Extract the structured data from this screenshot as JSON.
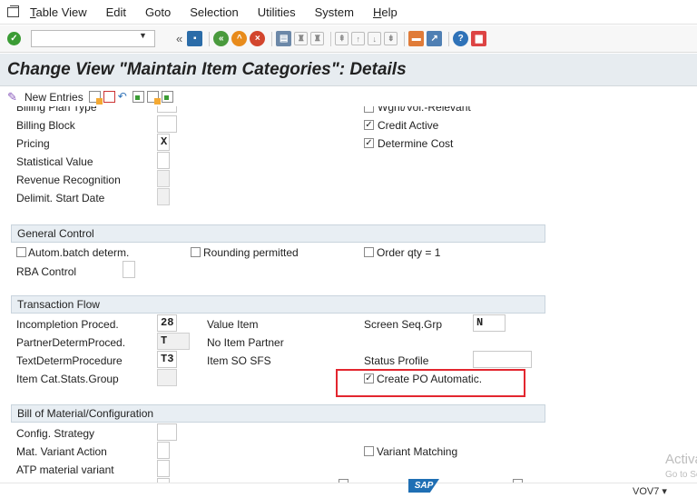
{
  "menubar": {
    "items": [
      {
        "underline": "T",
        "rest": "able View"
      },
      {
        "underline": "",
        "rest": "Edit"
      },
      {
        "underline": "",
        "rest": "Goto"
      },
      {
        "underline": "",
        "rest": "Selection"
      },
      {
        "underline": "",
        "rest": "Utilities"
      },
      {
        "underline": "",
        "rest": "System"
      },
      {
        "underline": "H",
        "rest": "elp"
      }
    ]
  },
  "toolbar": {
    "command_value": "",
    "back_label": "«"
  },
  "title": "Change View \"Maintain Item Categories\": Details",
  "apptoolbar": {
    "new_entries": "New Entries"
  },
  "upper": {
    "partial_label": "Billing Plan Type",
    "partial_right_label": "Wght/Vol.-Relevant",
    "billing_block": {
      "label": "Billing Block",
      "value": ""
    },
    "pricing": {
      "label": "Pricing",
      "value": "X"
    },
    "statistical_value": {
      "label": "Statistical Value",
      "value": ""
    },
    "revenue_recognition": {
      "label": "Revenue Recognition",
      "value": ""
    },
    "delimit_start": {
      "label": "Delimit. Start Date",
      "value": ""
    },
    "credit_active": {
      "label": "Credit Active",
      "checked": "✓"
    },
    "determine_cost": {
      "label": "Determine Cost",
      "checked": "✓"
    }
  },
  "general_control": {
    "title": "General Control",
    "autom_batch": {
      "label": "Autom.batch determ.",
      "checked": ""
    },
    "rounding": {
      "label": "Rounding permitted",
      "checked": ""
    },
    "order_qty": {
      "label": "Order qty = 1",
      "checked": ""
    },
    "rba": {
      "label": "RBA Control",
      "value": ""
    }
  },
  "transaction_flow": {
    "title": "Transaction Flow",
    "incompletion": {
      "label": "Incompletion Proced.",
      "value": "28",
      "desc": "Value Item"
    },
    "partner": {
      "label": "PartnerDetermProced.",
      "value": "T",
      "desc": "No Item Partner"
    },
    "text": {
      "label": "TextDetermProcedure",
      "value": "T3",
      "desc": "Item SO SFS"
    },
    "stats_group": {
      "label": "Item Cat.Stats.Group",
      "value": ""
    },
    "screen_seq": {
      "label": "Screen Seq.Grp",
      "value": "N"
    },
    "status_profile": {
      "label": "Status Profile",
      "value": ""
    },
    "create_po": {
      "label": "Create PO Automatic.",
      "checked": "✓"
    }
  },
  "bom": {
    "title": "Bill of Material/Configuration",
    "config_strategy": {
      "label": "Config. Strategy",
      "value": ""
    },
    "mat_variant": {
      "label": "Mat. Variant Action",
      "value": ""
    },
    "atp_variant": {
      "label": "ATP material variant",
      "value": ""
    },
    "variant_matching": {
      "label": "Variant Matching",
      "checked": ""
    }
  },
  "statusbar": {
    "sap": "SAP",
    "system": "VOV7 ▾"
  },
  "watermark": {
    "line1": "Activate Windows",
    "line2": "Go to Settings to activate Windows."
  },
  "colors": {
    "title_bg": "#e7ecf0",
    "section_bg": "#e8eef3",
    "highlight": "#e3262f"
  }
}
